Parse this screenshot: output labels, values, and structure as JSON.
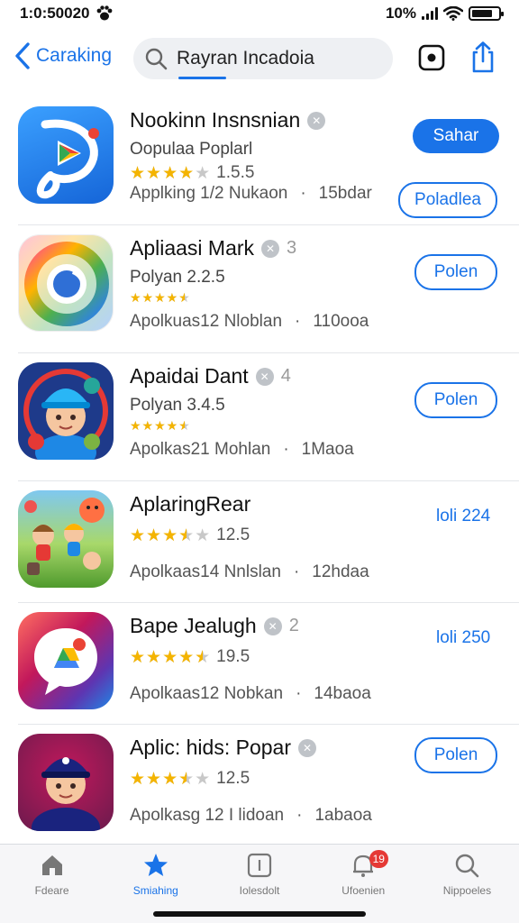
{
  "status_bar": {
    "time": "1:0:50020",
    "battery_text": "10%",
    "battery_level": 0.8
  },
  "header": {
    "back_label": "Caraking",
    "search_text": "Rayran Incadoia"
  },
  "apps": [
    {
      "name": "Nookinn Insnsnian",
      "badge_extra": "",
      "subtitle": "Oopulaa Poplarl",
      "stars": 4,
      "rating": "1.5.5",
      "meta_left": "Applking 1/2 Nukaon",
      "meta_right": "15bdar",
      "primary_button": "Sahar",
      "secondary_button": "Poladlea",
      "icon": "play-icon"
    },
    {
      "name": "Apliaasi Mark",
      "badge_extra": "3",
      "subtitle": "Polyan 2.2.5",
      "stars": 4.5,
      "rating": "",
      "meta_left": "Apolkuas12 Nloblan",
      "meta_right": "110ooa",
      "button": "Polen",
      "icon": "browser-icon"
    },
    {
      "name": "Apaidai Dant",
      "badge_extra": "4",
      "subtitle": "Polyan 3.4.5",
      "stars": 4.5,
      "rating": "",
      "meta_left": "Apolkas21 Mohlan",
      "meta_right": "1Maoa",
      "button": "Polen",
      "icon": "kid-avatar-icon"
    },
    {
      "name": "AplaringRear",
      "badge_extra": "",
      "subtitle": "",
      "stars": 3.5,
      "rating": "12.5",
      "meta_left": "Apolkaas14 Nnlslan",
      "meta_right": "12hdaa",
      "price": "loli 224",
      "icon": "cartoon-game-icon"
    },
    {
      "name": "Bape Jealugh",
      "badge_extra": "2",
      "subtitle": "",
      "stars": 4.5,
      "rating": "19.5",
      "meta_left": "Apolkaas12 Nobkan",
      "meta_right": "14baoa",
      "price": "loli 250",
      "icon": "chat-drive-icon"
    },
    {
      "name": "Aplic: hids: Popar",
      "badge_extra": "",
      "subtitle": "",
      "stars": 3.5,
      "rating": "12.5",
      "meta_left": "Apolkasg 12 I lidoan",
      "meta_right": "1abaoa",
      "button": "Polen",
      "icon": "boy-avatar-icon"
    }
  ],
  "tabs": [
    {
      "label": "Fdeare",
      "icon": "home-icon",
      "active": false
    },
    {
      "label": "Smiahing",
      "icon": "star-icon",
      "active": true
    },
    {
      "label": "Iolesdolt",
      "icon": "square-icon",
      "active": false
    },
    {
      "label": "Ufoenien",
      "icon": "bell-icon",
      "active": false,
      "badge": "19"
    },
    {
      "label": "Nippoeles",
      "icon": "search-icon",
      "active": false
    }
  ],
  "colors": {
    "accent": "#1a73e8",
    "star": "#f4b400",
    "badge_red": "#e53935"
  }
}
